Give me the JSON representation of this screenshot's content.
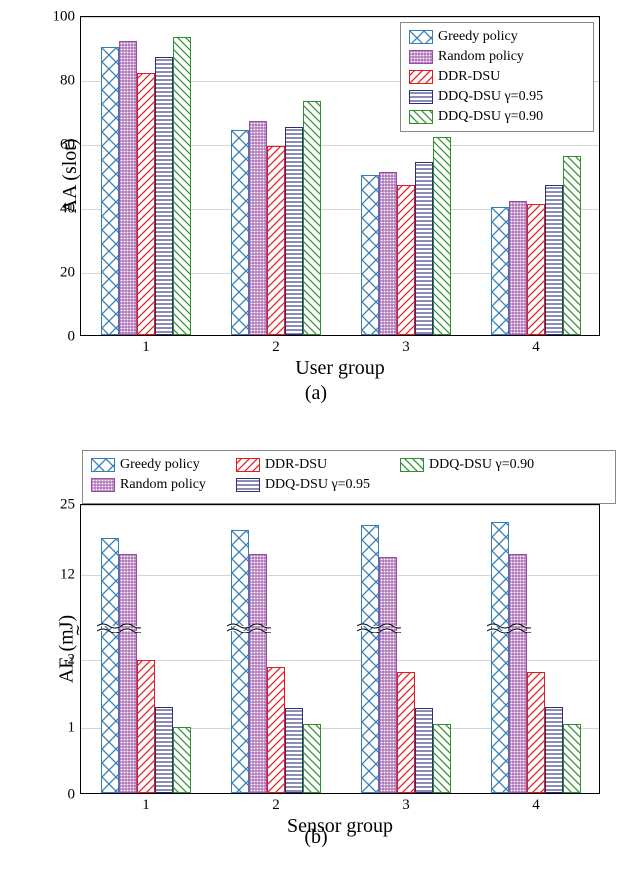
{
  "colors": {
    "greedy": "#377eb8",
    "random": "#984ea3",
    "ddr": "#e41a1c",
    "ddq95": "#2b2f7a",
    "ddq90": "#2f8f2f"
  },
  "series_labels": {
    "greedy": "Greedy policy",
    "random": "Random policy",
    "ddr": "DDR-DSU",
    "ddq95": "DDQ-DSU γ=0.95",
    "ddq90": "DDQ-DSU γ=0.90"
  },
  "chart_data": [
    {
      "id": "A",
      "type": "bar",
      "title": "",
      "sublabel": "(a)",
      "xlabel": "User group",
      "ylabel": "AA (slot)",
      "categories": [
        "1",
        "2",
        "3",
        "4"
      ],
      "series": [
        {
          "key": "greedy",
          "values": [
            90,
            64,
            50,
            40
          ]
        },
        {
          "key": "random",
          "values": [
            92,
            67,
            51,
            42
          ]
        },
        {
          "key": "ddr",
          "values": [
            82,
            59,
            47,
            41
          ]
        },
        {
          "key": "ddq95",
          "values": [
            87,
            65,
            54,
            47
          ]
        },
        {
          "key": "ddq90",
          "values": [
            93,
            73,
            62,
            56
          ]
        }
      ],
      "yticks": [
        0,
        20,
        40,
        60,
        80,
        100
      ],
      "ylim": [
        0,
        100
      ],
      "legend_pos": {
        "right": 6,
        "top": 6,
        "columns": 1
      }
    },
    {
      "id": "B",
      "type": "bar",
      "title": "",
      "sublabel": "(b)",
      "xlabel": "Sensor group",
      "ylabel": "AE (mJ)",
      "categories": [
        "1",
        "2",
        "3",
        "4"
      ],
      "series": [
        {
          "key": "greedy",
          "values": [
            18.5,
            20.0,
            21.0,
            21.5
          ]
        },
        {
          "key": "random",
          "values": [
            15.5,
            15.5,
            15.0,
            15.5
          ]
        },
        {
          "key": "ddr",
          "values": [
            1.97,
            1.88,
            1.8,
            1.8
          ]
        },
        {
          "key": "ddq95",
          "values": [
            1.28,
            1.26,
            1.27,
            1.28
          ]
        },
        {
          "key": "ddq90",
          "values": [
            0.98,
            1.02,
            1.02,
            1.03
          ]
        }
      ],
      "yticks_low": [
        0,
        1,
        2
      ],
      "yticks_high": [
        12,
        25
      ],
      "axis_break_at": 2.5,
      "ylim": [
        0,
        25
      ],
      "legend_pos": {
        "left": 6,
        "top": -54,
        "columns": 3
      }
    }
  ]
}
